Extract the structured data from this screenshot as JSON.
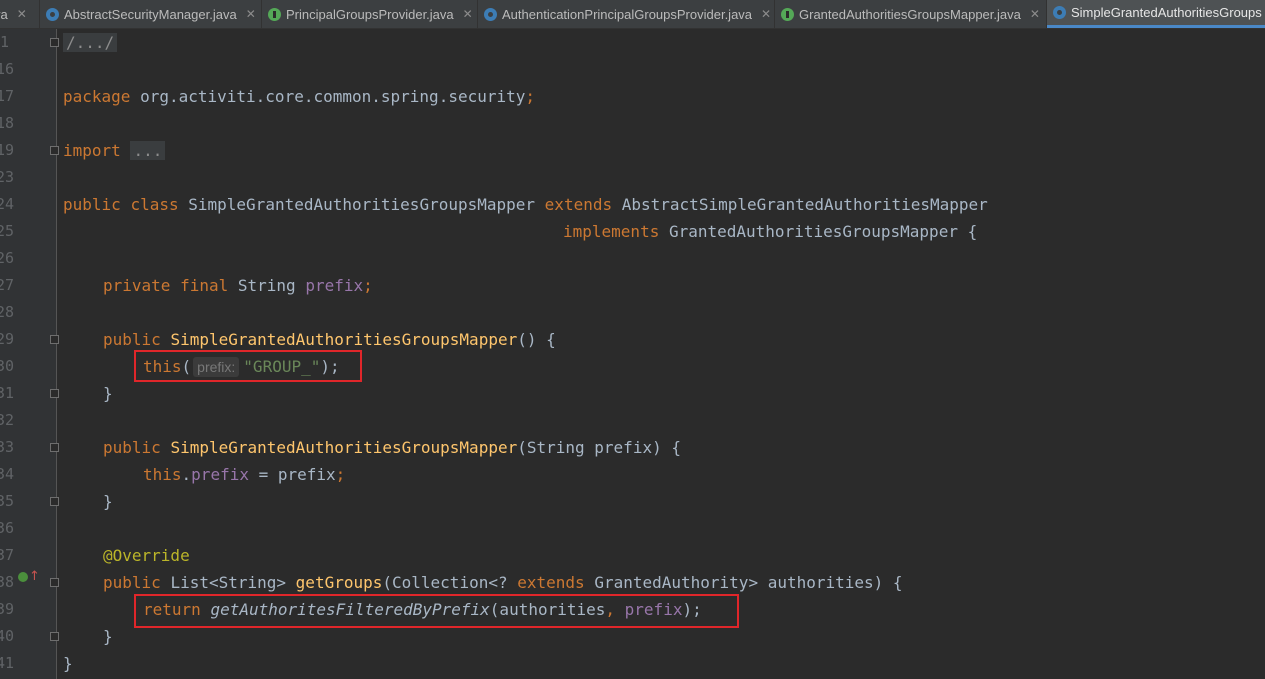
{
  "tabs": [
    {
      "label": "va",
      "icon": "class-icon",
      "active": false
    },
    {
      "label": "AbstractSecurityManager.java",
      "icon": "class-icon",
      "active": false
    },
    {
      "label": "PrincipalGroupsProvider.java",
      "icon": "interface-icon",
      "active": false
    },
    {
      "label": "AuthenticationPrincipalGroupsProvider.java",
      "icon": "class-icon",
      "active": false
    },
    {
      "label": "GrantedAuthoritiesGroupsMapper.java",
      "icon": "interface-icon",
      "active": false
    },
    {
      "label": "SimpleGrantedAuthoritiesGroups",
      "icon": "class-icon",
      "active": true
    }
  ],
  "close_glyph": "✕",
  "line_numbers": [
    "1",
    "16",
    "17",
    "18",
    "19",
    "23",
    "24",
    "25",
    "26",
    "27",
    "28",
    "29",
    "30",
    "31",
    "32",
    "33",
    "34",
    "35",
    "36",
    "37",
    "38",
    "39",
    "40",
    "41"
  ],
  "code": {
    "header_comment": "/.../",
    "kw_package": "package",
    "package_name": " org.activiti.core.common.spring.security",
    "semicolon": ";",
    "kw_import": "import",
    "import_folded": "...",
    "kw_public": "public",
    "kw_class": "class",
    "class_name": "SimpleGrantedAuthoritiesGroupsMapper",
    "kw_extends": "extends",
    "super_class": "AbstractSimpleGrantedAuthoritiesMapper",
    "kw_implements": "implements",
    "interface_name": "GrantedAuthoritiesGroupsMapper",
    "open_brace": " {",
    "kw_private": "private",
    "kw_final": "final",
    "type_string": "String",
    "field_prefix": "prefix",
    "ctor_name": "SimpleGrantedAuthoritiesGroupsMapper",
    "empty_params": "() {",
    "kw_this": "this",
    "param_hint": "prefix:",
    "group_literal": "\"GROUP_\"",
    "close_call": ");",
    "close_brace": "}",
    "ctor_params": "(String prefix) {",
    "assign": " = prefix",
    "annotation": "@Override",
    "list_type": "List<String>",
    "method_get_groups": "getGroups",
    "param_open": "(Collection<? ",
    "granted_authority": "GrantedAuthority> authorities) {",
    "kw_return": "return",
    "method_filter": "getAuthoritesFilteredByPrefix",
    "args_open": "(authorities",
    "comma": ", ",
    "args_close": ");"
  },
  "colors": {
    "keyword": "#cc7832",
    "field": "#9876aa",
    "method": "#ffc66d",
    "string": "#6a8759",
    "annotation": "#bbb529",
    "highlight_box": "#e0262a"
  }
}
